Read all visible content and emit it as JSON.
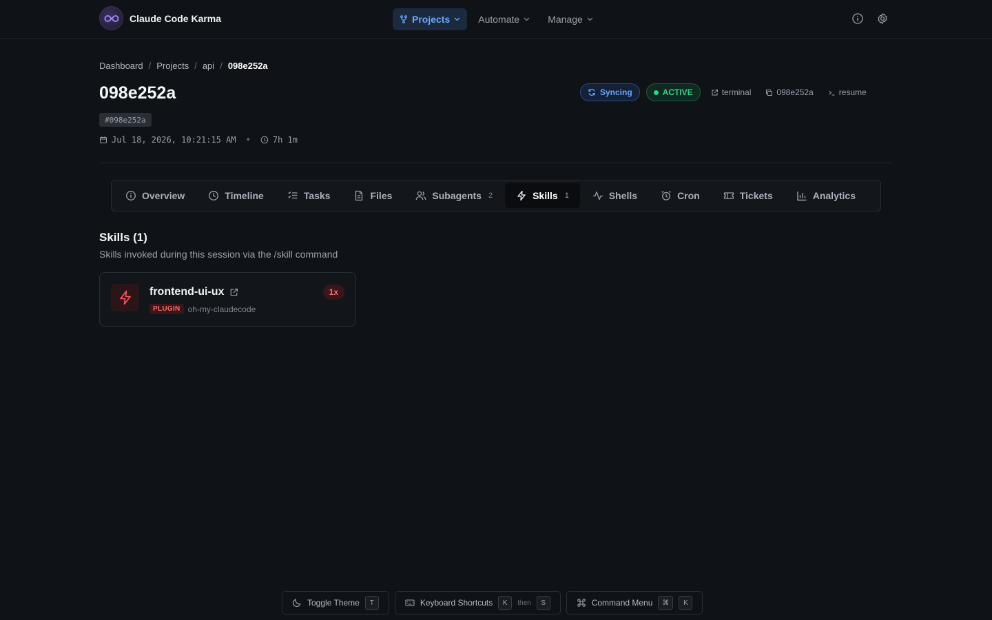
{
  "app": {
    "name": "Claude Code Karma"
  },
  "nav": {
    "items": [
      {
        "label": "Projects",
        "active": true
      },
      {
        "label": "Automate",
        "active": false
      },
      {
        "label": "Manage",
        "active": false
      }
    ],
    "icons": [
      "info-icon",
      "gear-icon"
    ]
  },
  "breadcrumb": {
    "items": [
      "Dashboard",
      "Projects",
      "api"
    ],
    "current": "098e252a",
    "separator": "/"
  },
  "session": {
    "title": "098e252a",
    "hash": "#098e252a",
    "date": "Jul 18, 2026, 10:21:15 AM",
    "duration": "7h 1m"
  },
  "header_actions": {
    "syncing": "Syncing",
    "status": "ACTIVE",
    "terminal": "terminal",
    "copy_id": "098e252a",
    "resume": "resume"
  },
  "tabs": [
    {
      "label": "Overview",
      "icon": "info-circle-icon"
    },
    {
      "label": "Timeline",
      "icon": "clock-icon"
    },
    {
      "label": "Tasks",
      "icon": "list-check-icon"
    },
    {
      "label": "Files",
      "icon": "file-icon"
    },
    {
      "label": "Subagents",
      "count": "2",
      "icon": "users-icon"
    },
    {
      "label": "Skills",
      "count": "1",
      "icon": "lightning-icon",
      "active": true
    },
    {
      "label": "Shells",
      "icon": "activity-icon"
    },
    {
      "label": "Cron",
      "icon": "alarm-icon"
    },
    {
      "label": "Tickets",
      "icon": "ticket-icon"
    },
    {
      "label": "Analytics",
      "icon": "bar-chart-icon"
    }
  ],
  "skills": {
    "title": "Skills (1)",
    "subtitle": "Skills invoked during this session via the /skill command",
    "items": [
      {
        "name": "frontend-ui-ux",
        "badge": "PLUGIN",
        "source": "oh-my-claudecode",
        "count": "1x"
      }
    ]
  },
  "footer": {
    "toggle_theme": {
      "label": "Toggle Theme",
      "key": "T"
    },
    "shortcuts": {
      "label": "Keyboard Shortcuts",
      "key1": "K",
      "then": "then",
      "key2": "S"
    },
    "command_menu": {
      "label": "Command Menu",
      "key1": "⌘",
      "key2": "K"
    }
  },
  "colors": {
    "background": "#0f1216",
    "accent": "#6aa8ff",
    "success": "#35d08a",
    "danger": "#ff6b6b"
  }
}
